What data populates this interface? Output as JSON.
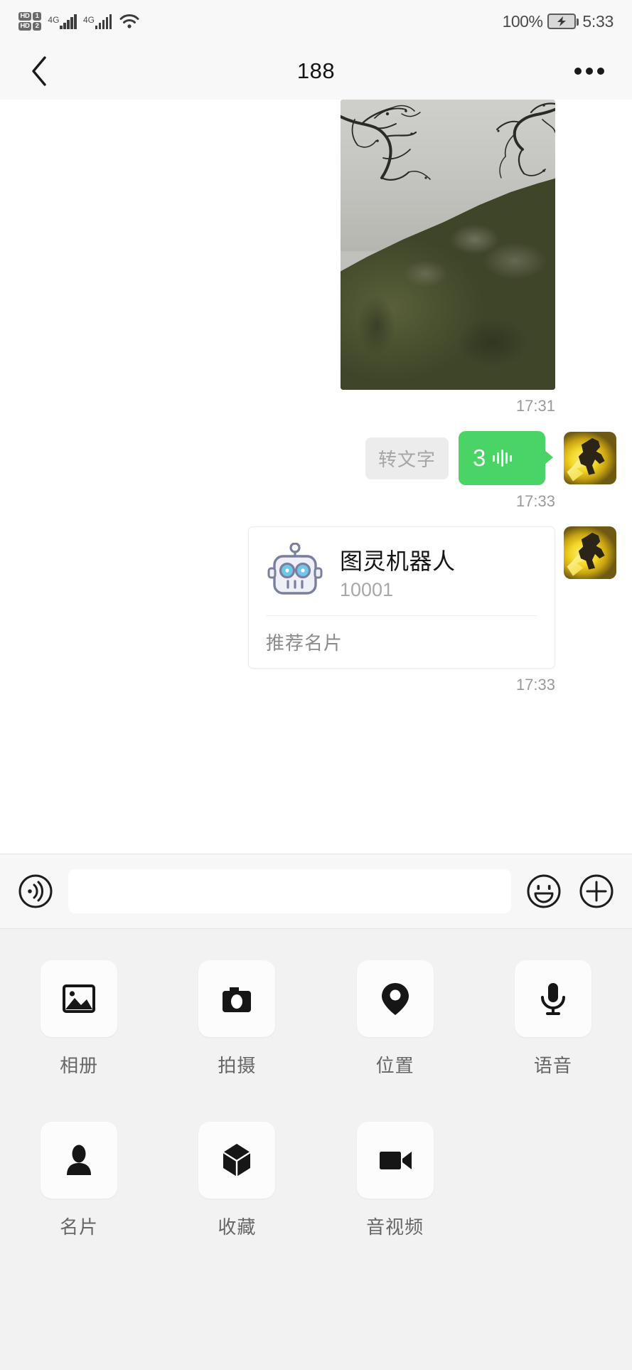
{
  "status_bar": {
    "hd1_label": "HD",
    "hd1_num": "1",
    "hd2_label": "HD",
    "hd2_num": "2",
    "network_1": "4G",
    "network_2": "4G",
    "wifi_icon": "wifi-icon",
    "battery_percent": "100%",
    "battery_state_icon": "battery-charging-icon",
    "time": "5:33"
  },
  "nav": {
    "back_icon": "chevron-left-icon",
    "title": "188",
    "more_icon": "more-horizontal-icon"
  },
  "messages": [
    {
      "type": "image",
      "sender": "self",
      "time": "17:31",
      "avatar_icon": "user-avatar-yellow"
    },
    {
      "type": "voice",
      "sender": "self",
      "transcribe_label": "转文字",
      "duration": "3",
      "wave_icon": "sound-wave-icon",
      "time": "17:33",
      "avatar_icon": "user-avatar-yellow"
    },
    {
      "type": "contact-card",
      "sender": "self",
      "card_title": "图灵机器人",
      "card_subtitle": "10001",
      "card_footer": "推荐名片",
      "card_icon": "robot-avatar-icon",
      "time": "17:33",
      "avatar_icon": "user-avatar-yellow"
    }
  ],
  "input_bar": {
    "voice_icon": "voice-record-icon",
    "input_value": "",
    "input_placeholder": "",
    "emoji_icon": "smiley-face-icon",
    "plus_icon": "plus-circle-icon"
  },
  "attachments": {
    "row1": [
      {
        "label": "相册",
        "icon": "photo-album-icon"
      },
      {
        "label": "拍摄",
        "icon": "camera-icon"
      },
      {
        "label": "位置",
        "icon": "location-pin-icon"
      },
      {
        "label": "语音",
        "icon": "microphone-icon"
      }
    ],
    "row2": [
      {
        "label": "名片",
        "icon": "contact-person-icon"
      },
      {
        "label": "收藏",
        "icon": "favorites-cube-icon"
      },
      {
        "label": "音视频",
        "icon": "video-camera-icon"
      }
    ]
  },
  "colors": {
    "accent_green": "#4ad465",
    "status_bg": "#f8f8f8",
    "panel_bg": "#f2f2f2",
    "timestamp_gray": "#9a9a9a"
  }
}
